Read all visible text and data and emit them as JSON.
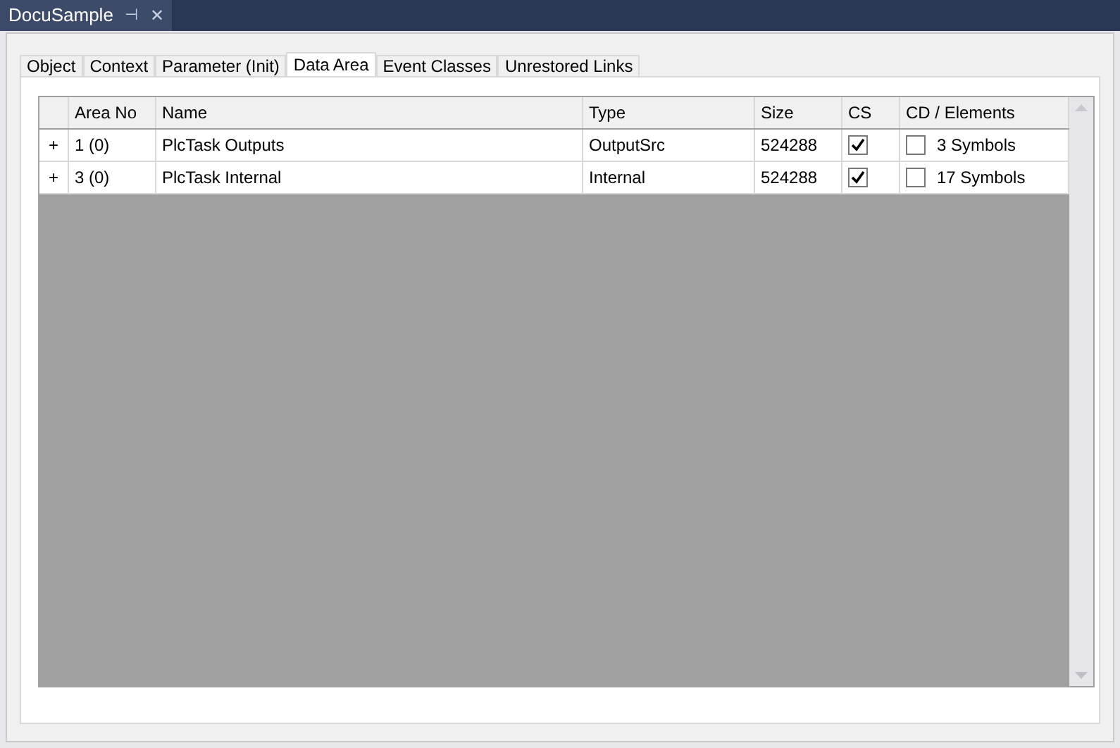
{
  "document_tab": {
    "title": "DocuSample",
    "pin": "⊣",
    "close": "✕"
  },
  "tabs": [
    {
      "label": "Object",
      "selected": false
    },
    {
      "label": "Context",
      "selected": false
    },
    {
      "label": "Parameter (Init)",
      "selected": false
    },
    {
      "label": "Data Area",
      "selected": true
    },
    {
      "label": "Event Classes",
      "selected": false
    },
    {
      "label": "Unrestored Links",
      "selected": false
    }
  ],
  "table": {
    "columns": [
      "Area No",
      "Name",
      "Type",
      "Size",
      "CS",
      "CD / Elements"
    ],
    "rows": [
      {
        "expander": "+",
        "area_no": "1 (0)",
        "name": "PlcTask Outputs",
        "type": "OutputSrc",
        "size": "524288",
        "cs_checked": true,
        "cd_checked": false,
        "elements": "3 Symbols"
      },
      {
        "expander": "+",
        "area_no": "3 (0)",
        "name": "PlcTask Internal",
        "type": "Internal",
        "size": "524288",
        "cs_checked": true,
        "cd_checked": false,
        "elements": "17 Symbols"
      }
    ]
  }
}
